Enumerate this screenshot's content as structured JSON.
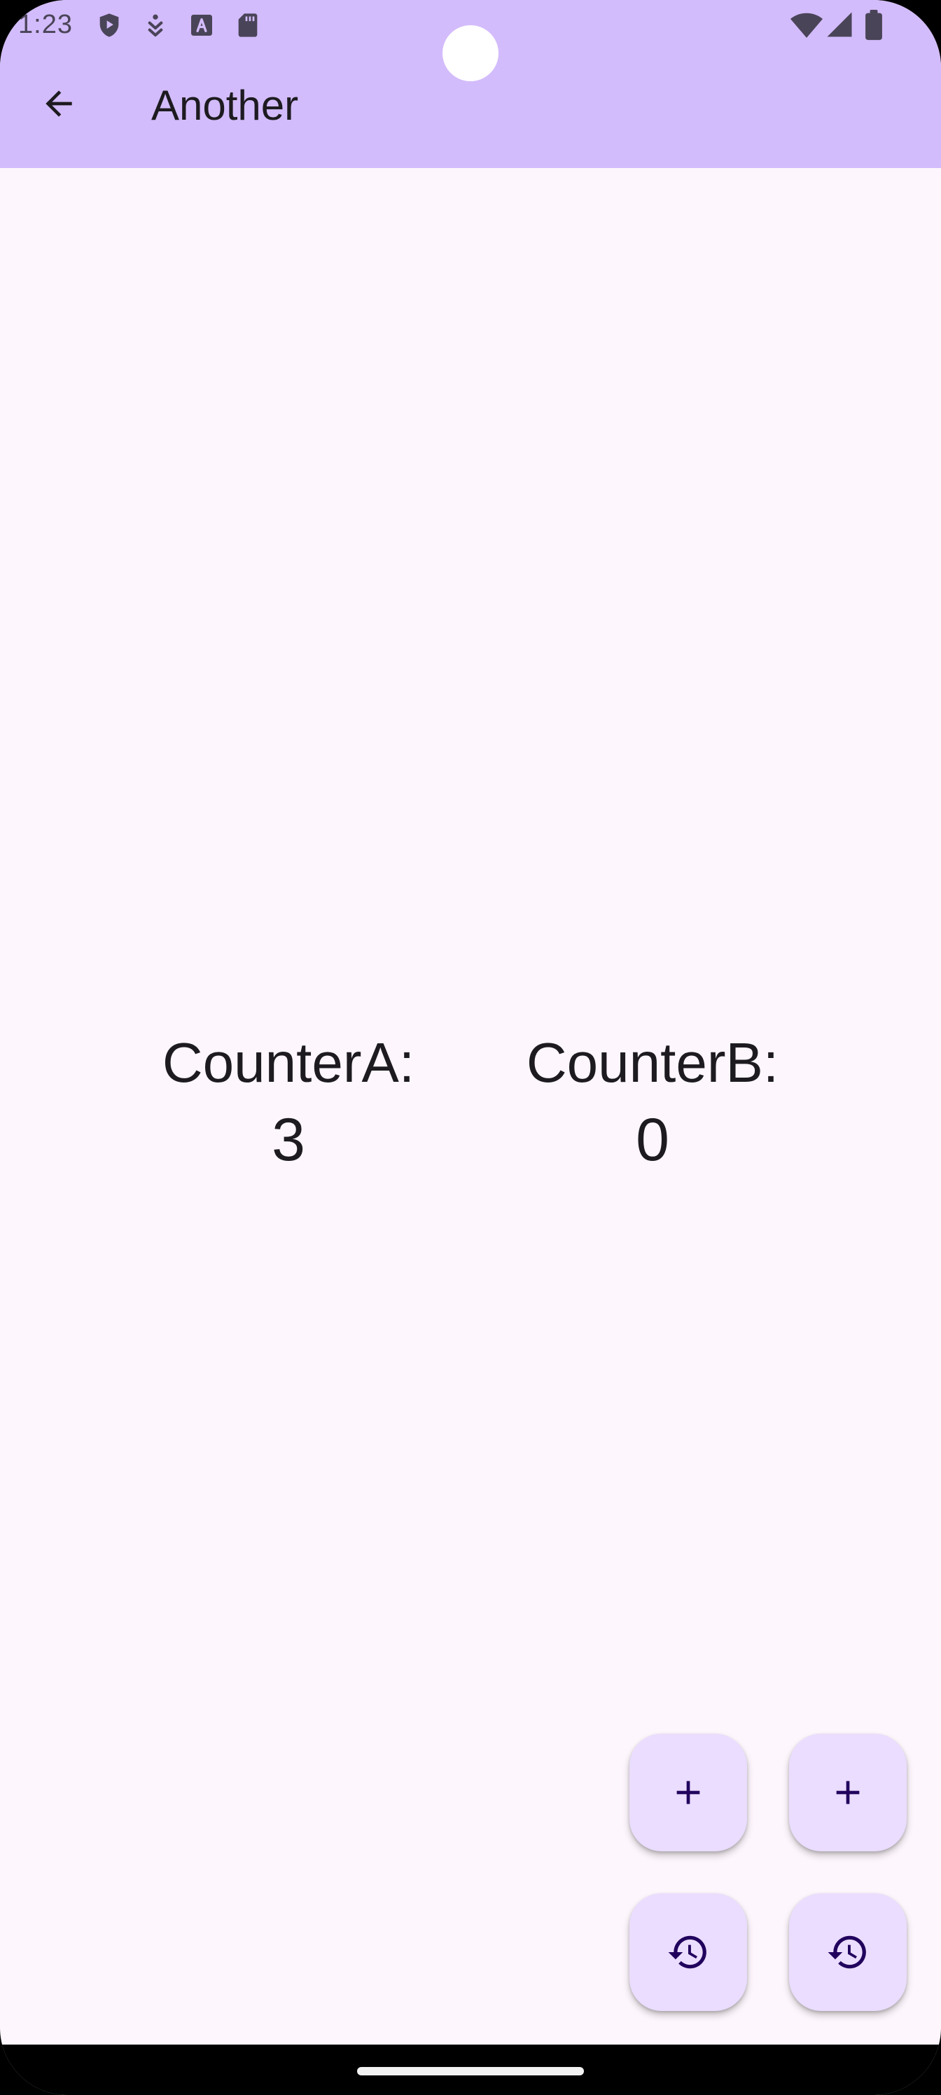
{
  "status_bar": {
    "time": "1:23",
    "left_icons": [
      "play-protect-icon",
      "accessibility-icon",
      "keyboard-a-icon",
      "sd-card-icon"
    ],
    "right_icons": [
      "wifi-icon",
      "cell-signal-icon",
      "battery-icon"
    ]
  },
  "app_bar": {
    "title": "Another",
    "back_icon": "arrow-back-icon"
  },
  "counters": {
    "a": {
      "label": "CounterA:",
      "value": "3"
    },
    "b": {
      "label": "CounterB:",
      "value": "0"
    }
  },
  "fabs": {
    "increment_icon": "add-icon",
    "reset_icon": "history-icon"
  },
  "colors": {
    "app_bar": "#D3BCFB",
    "background": "#FDF6FC",
    "fab": "#EADDFF",
    "on_fab": "#21005D",
    "text": "#1D1B20"
  }
}
